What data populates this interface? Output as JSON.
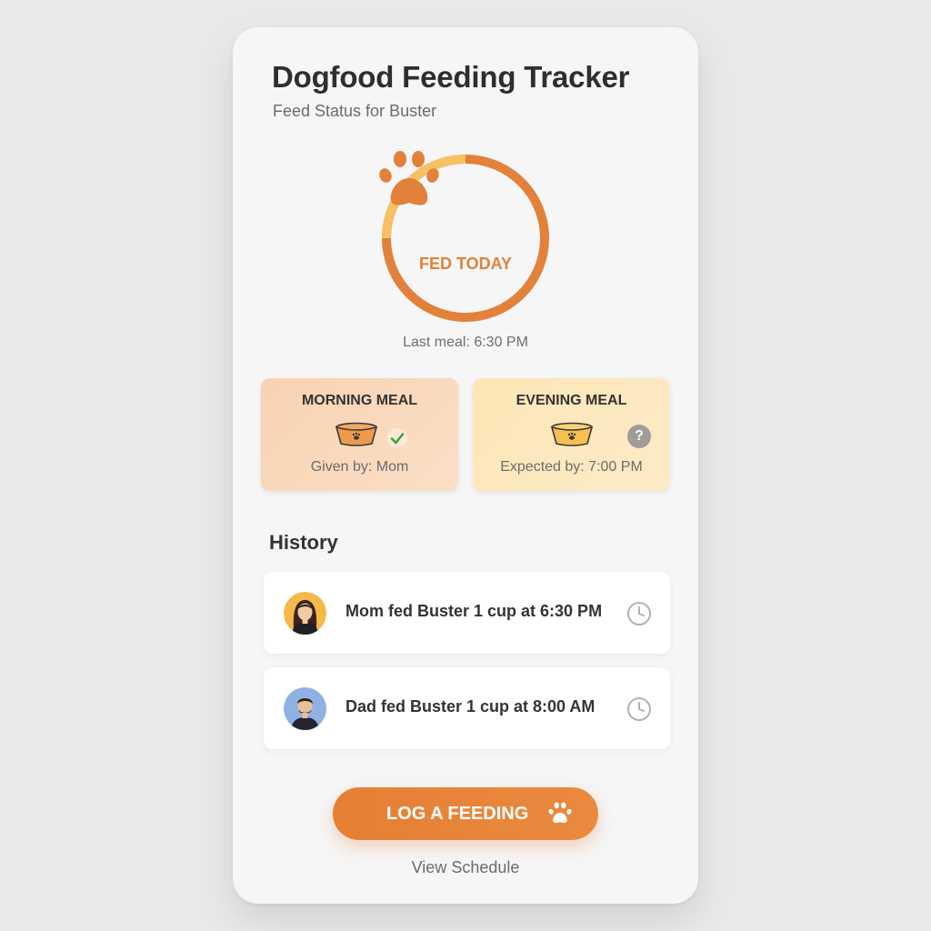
{
  "app": {
    "title": "Dogfood Feeding Tracker",
    "subtitle": "Feed Status for Buster"
  },
  "status": {
    "label": "FED TODAY",
    "last_meal": "Last meal: 6:30 PM",
    "icon": "paw-icon",
    "accent_color": "#e2813a",
    "secondary_color": "#f7c163"
  },
  "meals": {
    "morning": {
      "title": "MORNING MEAL",
      "detail": "Given by: Mom",
      "state_icon": "check-icon"
    },
    "evening": {
      "title": "EVENING MEAL",
      "detail": "Expected by: 7:00 PM",
      "state_icon": "question-icon",
      "state_symbol": "?"
    }
  },
  "history": {
    "title": "History",
    "items": [
      {
        "text": "Mom fed Buster 1 cup at 6:30 PM",
        "avatar": "mom-avatar",
        "icon": "clock-icon"
      },
      {
        "text": "Dad fed Buster 1 cup at 8:00 AM",
        "avatar": "dad-avatar",
        "icon": "clock-icon"
      }
    ]
  },
  "actions": {
    "log_feeding": "LOG A FEEDING",
    "view_schedule": "View Schedule"
  }
}
